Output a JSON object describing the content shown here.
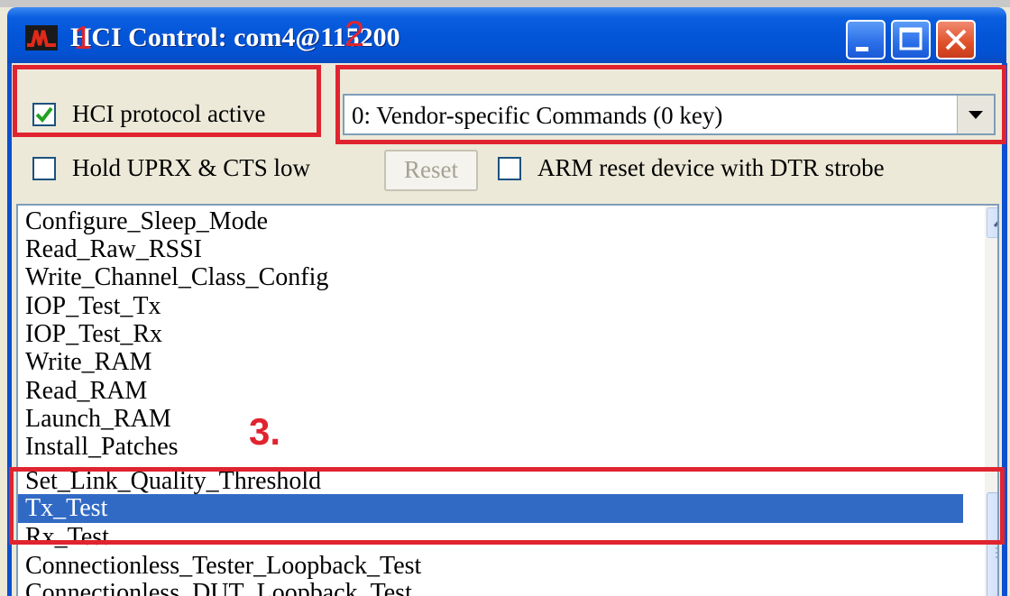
{
  "window": {
    "title": "HCI Control: com4@115200",
    "buttons": [
      "minimize-icon",
      "maximize-icon",
      "close-icon"
    ],
    "title_color": "#0354d6"
  },
  "controls": {
    "hci_protocol": {
      "label": "HCI protocol active",
      "checked": true
    },
    "command_set": {
      "selected": "0: Vendor-specific Commands (0 key)"
    },
    "hold_uprx": {
      "label": "Hold UPRX & CTS low",
      "checked": false
    },
    "reset_label": "Reset",
    "arm_reset": {
      "label": "ARM reset device with DTR strobe",
      "checked": false
    }
  },
  "command_list": {
    "items": [
      "Configure_Sleep_Mode",
      "Read_Raw_RSSI",
      "Write_Channel_Class_Config",
      "IOP_Test_Tx",
      "IOP_Test_Rx",
      "Write_RAM",
      "Read_RAM",
      "Launch_RAM",
      "Install_Patches",
      "Set_Link_Quality_Threshold",
      "Tx_Test",
      "Rx_Test",
      "Connectionless_Tester_Loopback_Test",
      "Connectionless_DUT_Loopback_Test"
    ],
    "selected": "Tx_Test",
    "selection_color": "#316ac5"
  },
  "annotations": {
    "one": "1",
    "two": "2",
    "three": "3.",
    "color": "#e0242f"
  }
}
